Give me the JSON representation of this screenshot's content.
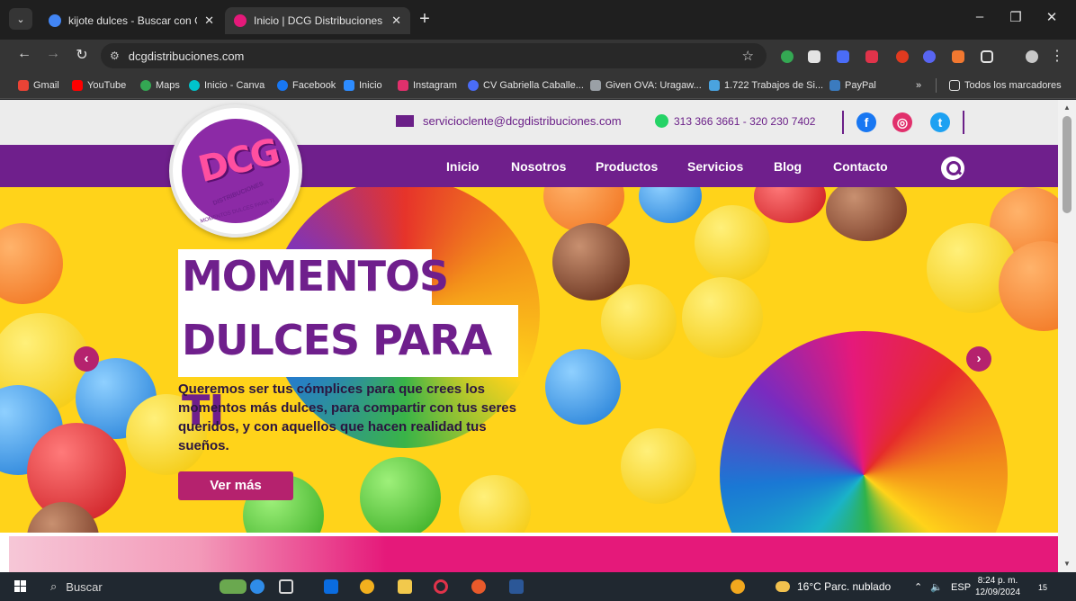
{
  "browser": {
    "tabs": [
      {
        "title": "kijote dulces - Buscar con Goog",
        "favicon_color": "#4285f4",
        "active": false
      },
      {
        "title": "Inicio | DCG Distribuciones",
        "favicon_color": "#e5197a",
        "active": true
      }
    ],
    "address": "dcgdistribuciones.com",
    "bookmarks": [
      {
        "label": "Gmail",
        "color": "#ea4335"
      },
      {
        "label": "YouTube",
        "color": "#ff0000"
      },
      {
        "label": "Maps",
        "color": "#34a853"
      },
      {
        "label": "Inicio - Canva",
        "color": "#00c4cc"
      },
      {
        "label": "Facebook",
        "color": "#1877f2"
      },
      {
        "label": "Inicio",
        "color": "#2d8cff"
      },
      {
        "label": "Instagram",
        "color": "#e1306c"
      },
      {
        "label": "CV Gabriella Caballe...",
        "color": "#4a6cf7"
      },
      {
        "label": "Given OVA: Uragaw...",
        "color": "#9aa0a6"
      },
      {
        "label": "1.722 Trabajos de Si...",
        "color": "#4aa3df"
      },
      {
        "label": "PayPal",
        "color": "#3b7bbf"
      }
    ],
    "all_bookmarks": "Todos los marcadores",
    "more_chevron": "»"
  },
  "site": {
    "email": "servicioclente@dcgdistribuciones.com",
    "phone": "313 366 3661 - 320 230 7402",
    "nav": [
      "Inicio",
      "Nosotros",
      "Productos",
      "Servicios",
      "Blog",
      "Contacto"
    ],
    "logo_text": "DCG",
    "logo_sub": "DISTRIBUCIONES",
    "logo_tagline": "MOMENTOS DULCES PARA TI",
    "hero": {
      "line1": "MOMENTOS",
      "line2": "DULCES PARA TI",
      "lead": "Queremos ser tus cómplices para que crees los momentos más dulces, para compartir con tus seres queridos, y con aquellos que hacen realidad tus sueños.",
      "button": "Ver más"
    },
    "colors": {
      "purple": "#6f1f8c",
      "magenta": "#b5226e",
      "pink": "#e5197a",
      "yellow": "#ffd31a"
    }
  },
  "taskbar": {
    "search": "Buscar",
    "weather": "16°C  Parc. nublado",
    "lang": "ESP",
    "time": "8:24 p. m.",
    "date": "12/09/2024",
    "notifications": "15"
  }
}
